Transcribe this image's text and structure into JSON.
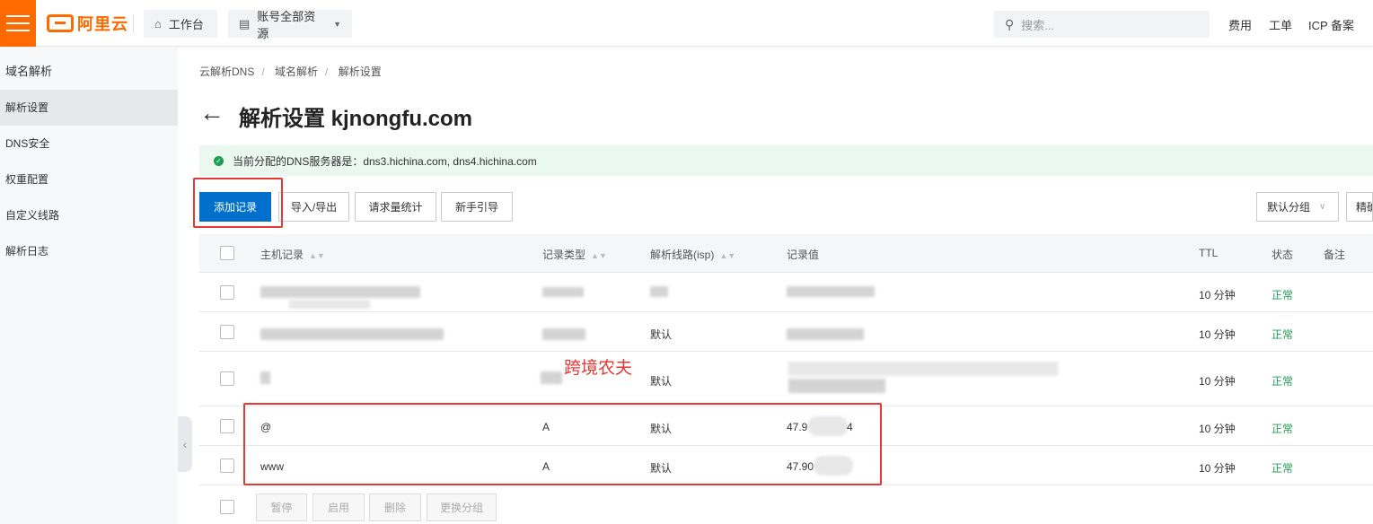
{
  "topbar": {
    "logo_text": "阿里云",
    "workbench_label": "工作台",
    "resources_label": "账号全部资源",
    "search_placeholder": "搜索...",
    "links": [
      "费用",
      "工单",
      "ICP 备案"
    ]
  },
  "sidebar": {
    "title": "域名解析",
    "items": [
      {
        "label": "解析设置",
        "active": true
      },
      {
        "label": "DNS安全",
        "active": false
      },
      {
        "label": "权重配置",
        "active": false
      },
      {
        "label": "自定义线路",
        "active": false
      },
      {
        "label": "解析日志",
        "active": false
      }
    ]
  },
  "breadcrumb": [
    "云解析DNS",
    "域名解析",
    "解析设置"
  ],
  "page": {
    "title": "解析设置 kjnongfu.com",
    "notice": "当前分配的DNS服务器是：dns3.hichina.com, dns4.hichina.com"
  },
  "toolbar": {
    "add_record": "添加记录",
    "import_export": "导入/导出",
    "request_stats": "请求量统计",
    "beginner_guide": "新手引导",
    "group_select": "默认分组",
    "precise_search": "精确"
  },
  "annotation": "跨境农夫",
  "table": {
    "headers": {
      "host": "主机记录",
      "type": "记录类型",
      "line": "解析线路(isp)",
      "value": "记录值",
      "ttl": "TTL",
      "status": "状态",
      "remark": "备注"
    },
    "rows": [
      {
        "host": "",
        "type": "",
        "line": "",
        "value": "",
        "ttl": "10 分钟",
        "status": "正常"
      },
      {
        "host": "",
        "type": "",
        "line": "默认",
        "value": "",
        "ttl": "10 分钟",
        "status": "正常"
      },
      {
        "host": "",
        "type": "",
        "line": "默认",
        "value": "",
        "ttl": "10 分钟",
        "status": "正常"
      },
      {
        "host": "@",
        "type": "A",
        "line": "默认",
        "value": "47.9",
        "value_suffix": "4",
        "ttl": "10 分钟",
        "status": "正常"
      },
      {
        "host": "www",
        "type": "A",
        "line": "默认",
        "value": "47.90",
        "value_suffix": "",
        "ttl": "10 分钟",
        "status": "正常"
      }
    ]
  },
  "footer_buttons": {
    "pause": "暂停",
    "enable": "启用",
    "delete": "删除",
    "change_group": "更换分组"
  },
  "colors": {
    "brand": "#ff6a00",
    "primary": "#0070cc",
    "success": "#1e9e52",
    "annotation": "#e53935"
  }
}
